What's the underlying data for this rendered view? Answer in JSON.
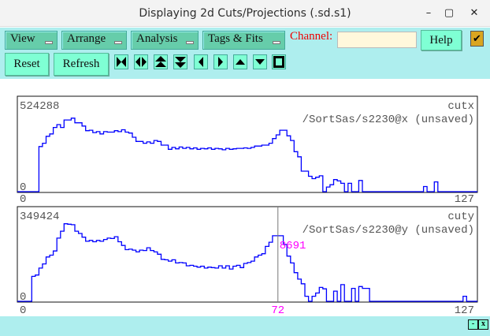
{
  "window": {
    "title": "Displaying 2d Cuts/Projections (.sd.s1)",
    "min": "–",
    "max": "▢",
    "close": "✕"
  },
  "toolbar": {
    "menus": [
      "View",
      "Arrange",
      "Analysis",
      "Tags & Fits"
    ],
    "channel_label": "Channel:",
    "channel_value": "",
    "help": "Help",
    "check": "✔",
    "reset": "Reset",
    "refresh": "Refresh",
    "icons": [
      "expand-horizontal-icon",
      "compress-horizontal-icon",
      "expand-vertical-icon",
      "compress-vertical-icon",
      "scroll-left-icon",
      "scroll-right-icon",
      "scroll-up-icon",
      "scroll-down-icon",
      "full-view-icon"
    ]
  },
  "colors": {
    "toolbar": "#aeeeee",
    "menu": "#66cdaa",
    "button": "#7fffd4",
    "trace": "#0000ff",
    "cursor": "#ff00ff",
    "channel_label": "#ee0000"
  },
  "chart_data": [
    {
      "type": "histogram",
      "title": "cutx",
      "subtitle": "/SortSas/s2230@x (unsaved)",
      "ymax_label": "524288",
      "ymin_label": "0",
      "xmin_label": "0",
      "xmax_label": "127",
      "ylim": [
        0,
        524288
      ],
      "xlim": [
        0,
        127
      ],
      "values_fraction_of_max": [
        0,
        0,
        0,
        0,
        0,
        0,
        0.485,
        0.52,
        0.595,
        0.62,
        0.69,
        0.72,
        0.69,
        0.77,
        0.77,
        0.79,
        0.74,
        0.74,
        0.705,
        0.655,
        0.66,
        0.635,
        0.645,
        0.62,
        0.645,
        0.64,
        0.64,
        0.655,
        0.645,
        0.665,
        0.64,
        0.63,
        0.585,
        0.54,
        0.54,
        0.52,
        0.535,
        0.52,
        0.55,
        0.54,
        0.5,
        0.5,
        0.455,
        0.475,
        0.46,
        0.48,
        0.465,
        0.475,
        0.46,
        0.47,
        0.455,
        0.465,
        0.46,
        0.47,
        0.455,
        0.465,
        0.46,
        0.45,
        0.465,
        0.455,
        0.46,
        0.465,
        0.465,
        0.47,
        0.465,
        0.475,
        0.49,
        0.49,
        0.5,
        0.5,
        0.52,
        0.57,
        0.61,
        0.66,
        0.66,
        0.6,
        0.55,
        0.43,
        0.375,
        0.22,
        0.22,
        0.165,
        0.14,
        0.155,
        0.17,
        0,
        0.05,
        0.075,
        0.13,
        0.115,
        0.09,
        0,
        0.09,
        0,
        0,
        0.12,
        0,
        0,
        0,
        0,
        0,
        0,
        0,
        0,
        0,
        0,
        0,
        0,
        0,
        0,
        0,
        0,
        0,
        0.055,
        0,
        0,
        0.105,
        0,
        0,
        0,
        0,
        0,
        0,
        0,
        0,
        0,
        0,
        0
      ]
    },
    {
      "type": "histogram",
      "title": "cuty",
      "subtitle": "/SortSas/s2230@y (unsaved)",
      "ymax_label": "349424",
      "ymin_label": "0",
      "xmin_label": "0",
      "xmax_label": "127",
      "cursor_x": "72",
      "cursor_value": "8691",
      "ylim": [
        0,
        349424
      ],
      "xlim": [
        0,
        127
      ],
      "values_fraction_of_max": [
        0,
        0,
        0,
        0,
        0.27,
        0.285,
        0.36,
        0.405,
        0.48,
        0.5,
        0.545,
        0.685,
        0.76,
        0.84,
        0.835,
        0.83,
        0.76,
        0.735,
        0.695,
        0.65,
        0.66,
        0.645,
        0.66,
        0.65,
        0.67,
        0.685,
        0.68,
        0.7,
        0.645,
        0.605,
        0.56,
        0.565,
        0.555,
        0.535,
        0.555,
        0.55,
        0.58,
        0.55,
        0.535,
        0.51,
        0.455,
        0.45,
        0.435,
        0.45,
        0.415,
        0.42,
        0.415,
        0.385,
        0.39,
        0.38,
        0.37,
        0.38,
        0.36,
        0.37,
        0.365,
        0.36,
        0.385,
        0.36,
        0.385,
        0.35,
        0.38,
        0.39,
        0.365,
        0.41,
        0.42,
        0.435,
        0.48,
        0.5,
        0.515,
        0.595,
        0.64,
        0.71,
        0.71,
        0.71,
        0.615,
        0.49,
        0.415,
        0.31,
        0.24,
        0.19,
        0.055,
        0,
        0.055,
        0.09,
        0.15,
        0.135,
        0,
        0,
        0.11,
        0,
        0.18,
        0,
        0,
        0.14,
        0,
        0.16,
        0.14,
        0.14,
        0,
        0,
        0,
        0,
        0,
        0,
        0,
        0,
        0,
        0,
        0,
        0,
        0,
        0,
        0,
        0,
        0,
        0,
        0,
        0,
        0,
        0,
        0,
        0,
        0,
        0,
        0.055,
        0,
        0,
        0
      ]
    }
  ],
  "statusbar": {
    "btn1": "-",
    "btn2": "x"
  }
}
